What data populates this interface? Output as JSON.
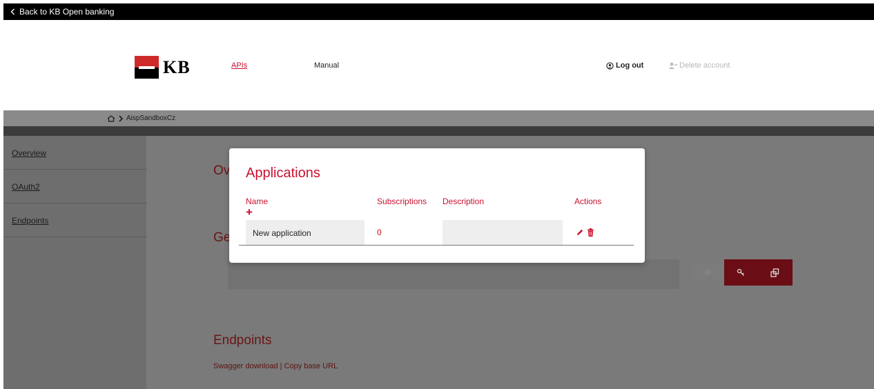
{
  "topbar": {
    "back_label": "Back to KB Open banking"
  },
  "header": {
    "logo_text": "KB",
    "nav": {
      "apis": "APIs",
      "manual": "Manual"
    },
    "logout": "Log out",
    "delete_account": "Delete account"
  },
  "breadcrumb": {
    "current": "AispSandboxCz"
  },
  "sidebar": {
    "items": [
      {
        "label": "Overview"
      },
      {
        "label": "OAuth2"
      },
      {
        "label": "Endpoints"
      }
    ]
  },
  "main": {
    "overview_heading": "Ov",
    "general_heading": "Ge",
    "endpoints_heading": "Endpoints",
    "swagger_links": "Swagger download | Copy base URL"
  },
  "modal": {
    "title": "Applications",
    "columns": {
      "name": "Name",
      "subscriptions": "Subscriptions",
      "description": "Description",
      "actions": "Actions"
    },
    "add_symbol": "+",
    "rows": [
      {
        "name": "New application",
        "subscriptions": "0",
        "description": ""
      }
    ]
  },
  "colors": {
    "accent": "#c8102e",
    "topbar": "#000000",
    "overlay_gray": "#7a7a7a"
  },
  "icons": [
    "chevron-left-icon",
    "home-icon",
    "chevron-right-icon",
    "user-circle-icon",
    "user-delete-icon",
    "eye-icon",
    "key-icon",
    "copy-icon",
    "plus-icon",
    "pencil-icon",
    "trash-icon"
  ]
}
